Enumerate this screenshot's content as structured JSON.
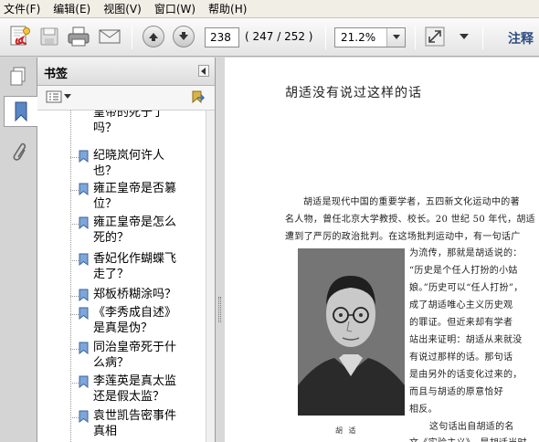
{
  "menubar": {
    "items": [
      "文件(F)",
      "编辑(E)",
      "视图(V)",
      "窗口(W)",
      "帮助(H)"
    ]
  },
  "toolbar": {
    "current_page": "238",
    "page_count": "( 247 / 252 )",
    "zoom": "21.2%",
    "annotate_label": "注释",
    "icons": [
      "create-pdf-icon",
      "save-icon",
      "print-icon",
      "email-icon",
      "previous-page-icon",
      "next-page-icon",
      "zoom-dropdown-icon",
      "fit-window-icon",
      "more-tools-icon"
    ]
  },
  "nav": {
    "icons": [
      "page-thumbnails-icon",
      "bookmarks-icon",
      "attachments-icon"
    ]
  },
  "bookmarks": {
    "title": "书签",
    "items": [
      "皇帝的死于了",
      "吗？",
      "纪晓岚何许人",
      "也？",
      "雍正皇帝是否篡",
      "位？",
      "雍正皇帝是怎么",
      "死的？",
      "香妃化作蝴蝶飞",
      "走了？",
      "郑板桥糊涂吗？",
      "《李秀成自述》",
      "是真是伪？",
      "同治皇帝死于什",
      "么病？",
      "李莲英是真太监",
      "还是假太监？",
      "袁世凯告密事件",
      "真相"
    ]
  },
  "document": {
    "title": "胡适没有说过这样的话",
    "lines": [
      "胡适是现代中国的重要学者，五四新文化运动中的著",
      "名人物，曾任北京大学教授、校长。20 世纪 50 年代，胡适",
      "遭到了严厉的政治批判。在这场批判运动中，有一句话广",
      "为流传，那就是胡适说的：",
      "“历史是个任人打扮的小姑",
      "娘。”历史可以“任人打扮”，",
      "成了胡适唯心主义历史观",
      "的罪证。但近来却有学者",
      "站出来证明：胡适从来就没",
      "有说过那样的话。那句话",
      "是由另外的话变化过来的，",
      "而且与胡适的原意恰好",
      "相反。",
      "这句话出自胡适的名",
      "文《实验主义》，是胡适当时"
    ],
    "photo_caption": "胡 适"
  }
}
